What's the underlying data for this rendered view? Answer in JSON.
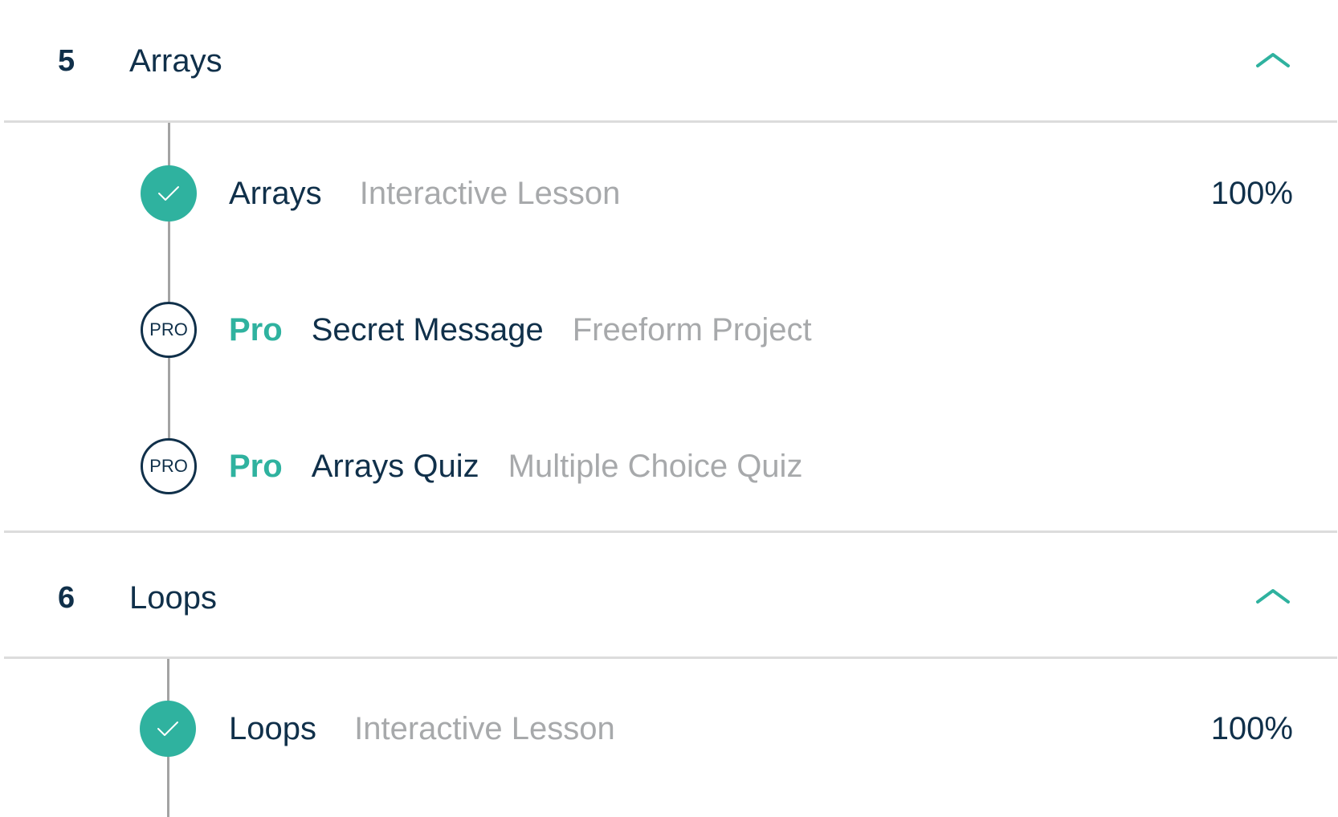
{
  "colors": {
    "accent": "#2fb29f",
    "text_primary": "#10304a",
    "text_muted": "#a7a9ab",
    "divider": "#dcdcdc",
    "timeline": "#a3a3a3"
  },
  "modules": [
    {
      "number": "5",
      "title": "Arrays",
      "expand_icon": "chevron-up-icon",
      "items": [
        {
          "status_icon": "check-icon",
          "title": "Arrays",
          "type": "Interactive Lesson",
          "progress": "100%"
        },
        {
          "status_icon": "pro-badge",
          "badge_text": "PRO",
          "pro_label": "Pro",
          "title": "Secret Message",
          "type": "Freeform Project"
        },
        {
          "status_icon": "pro-badge",
          "badge_text": "PRO",
          "pro_label": "Pro",
          "title": "Arrays Quiz",
          "type": "Multiple Choice Quiz"
        }
      ]
    },
    {
      "number": "6",
      "title": "Loops",
      "expand_icon": "chevron-up-icon",
      "items": [
        {
          "status_icon": "check-icon",
          "title": "Loops",
          "type": "Interactive Lesson",
          "progress": "100%"
        }
      ]
    }
  ]
}
